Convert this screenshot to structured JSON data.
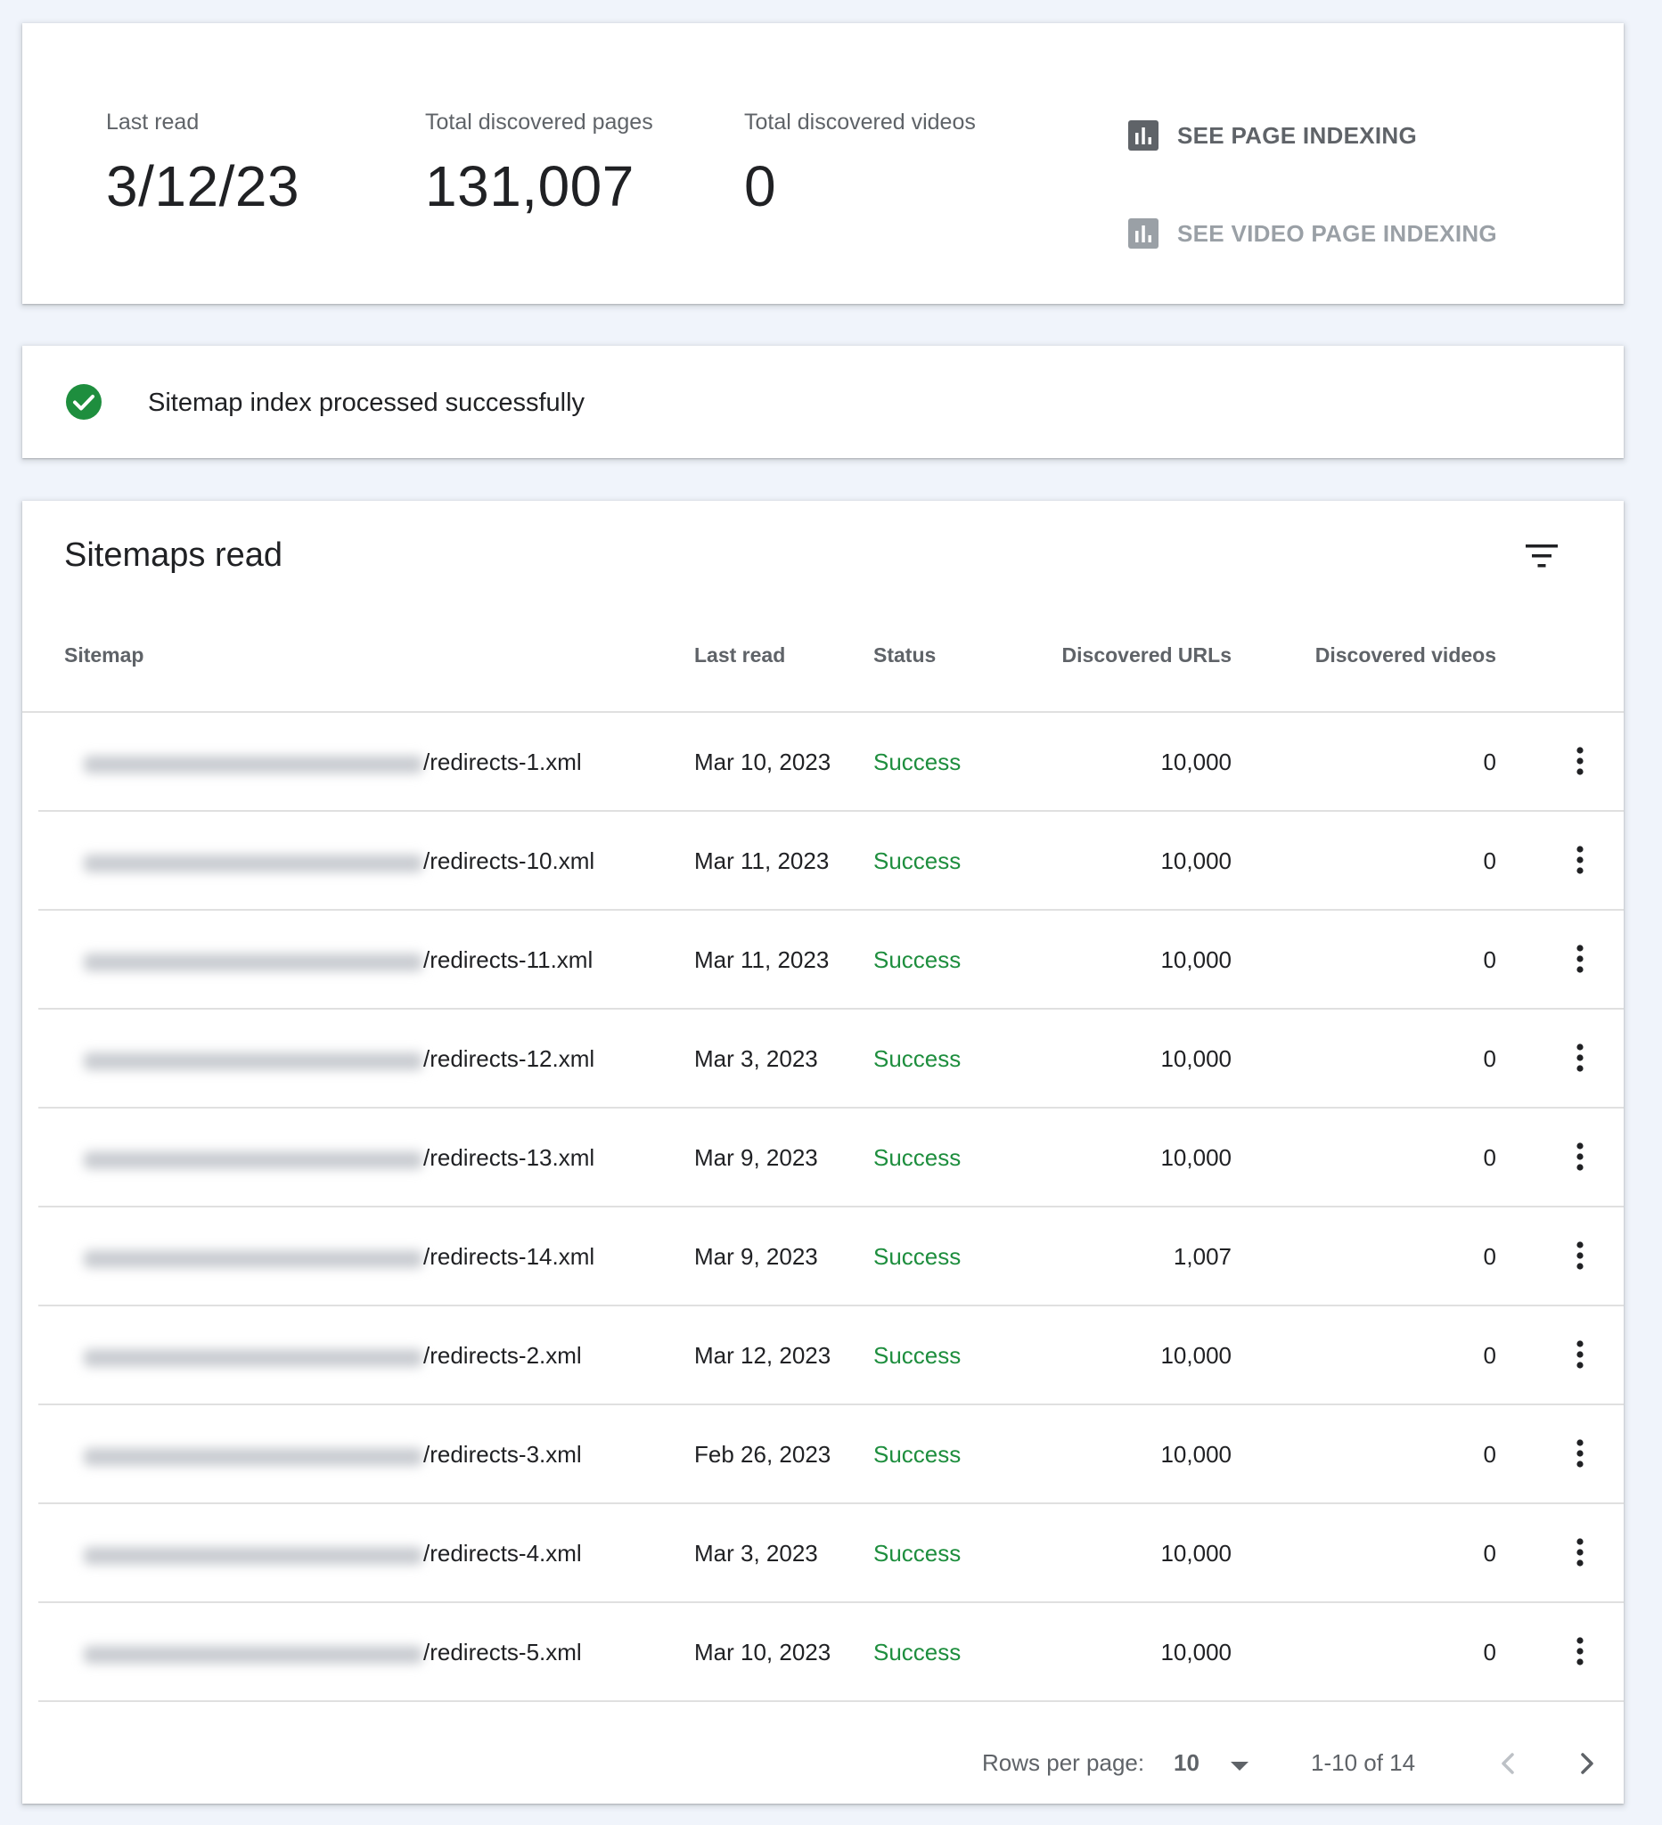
{
  "summary": {
    "last_read_label": "Last read",
    "last_read_value": "3/12/23",
    "pages_label": "Total discovered pages",
    "pages_value": "131,007",
    "videos_label": "Total discovered videos",
    "videos_value": "0",
    "see_page_indexing": "SEE PAGE INDEXING",
    "see_video_page_indexing": "SEE VIDEO PAGE INDEXING"
  },
  "status": {
    "message": "Sitemap index processed successfully",
    "color": "#1e8e3e"
  },
  "table": {
    "title": "Sitemaps read",
    "columns": {
      "sitemap": "Sitemap",
      "last_read": "Last read",
      "status": "Status",
      "discovered_urls": "Discovered URLs",
      "discovered_videos": "Discovered videos"
    },
    "rows": [
      {
        "sitemap": "/redirects-1.xml",
        "last_read": "Mar 10, 2023",
        "status": "Success",
        "urls": "10,000",
        "videos": "0"
      },
      {
        "sitemap": "/redirects-10.xml",
        "last_read": "Mar 11, 2023",
        "status": "Success",
        "urls": "10,000",
        "videos": "0"
      },
      {
        "sitemap": "/redirects-11.xml",
        "last_read": "Mar 11, 2023",
        "status": "Success",
        "urls": "10,000",
        "videos": "0"
      },
      {
        "sitemap": "/redirects-12.xml",
        "last_read": "Mar 3, 2023",
        "status": "Success",
        "urls": "10,000",
        "videos": "0"
      },
      {
        "sitemap": "/redirects-13.xml",
        "last_read": "Mar 9, 2023",
        "status": "Success",
        "urls": "10,000",
        "videos": "0"
      },
      {
        "sitemap": "/redirects-14.xml",
        "last_read": "Mar 9, 2023",
        "status": "Success",
        "urls": "1,007",
        "videos": "0"
      },
      {
        "sitemap": "/redirects-2.xml",
        "last_read": "Mar 12, 2023",
        "status": "Success",
        "urls": "10,000",
        "videos": "0"
      },
      {
        "sitemap": "/redirects-3.xml",
        "last_read": "Feb 26, 2023",
        "status": "Success",
        "urls": "10,000",
        "videos": "0"
      },
      {
        "sitemap": "/redirects-4.xml",
        "last_read": "Mar 3, 2023",
        "status": "Success",
        "urls": "10,000",
        "videos": "0"
      },
      {
        "sitemap": "/redirects-5.xml",
        "last_read": "Mar 10, 2023",
        "status": "Success",
        "urls": "10,000",
        "videos": "0"
      }
    ]
  },
  "pagination": {
    "rows_per_page_label": "Rows per page:",
    "rows_per_page_value": "10",
    "range": "1-10 of 14"
  },
  "icons": {
    "indexing": "bar-chart-icon",
    "status": "check-circle-icon",
    "filter": "filter-icon",
    "more": "more-vert-icon",
    "dropdown": "arrow-drop-down-icon",
    "prev": "chevron-left-icon",
    "next": "chevron-right-icon"
  }
}
